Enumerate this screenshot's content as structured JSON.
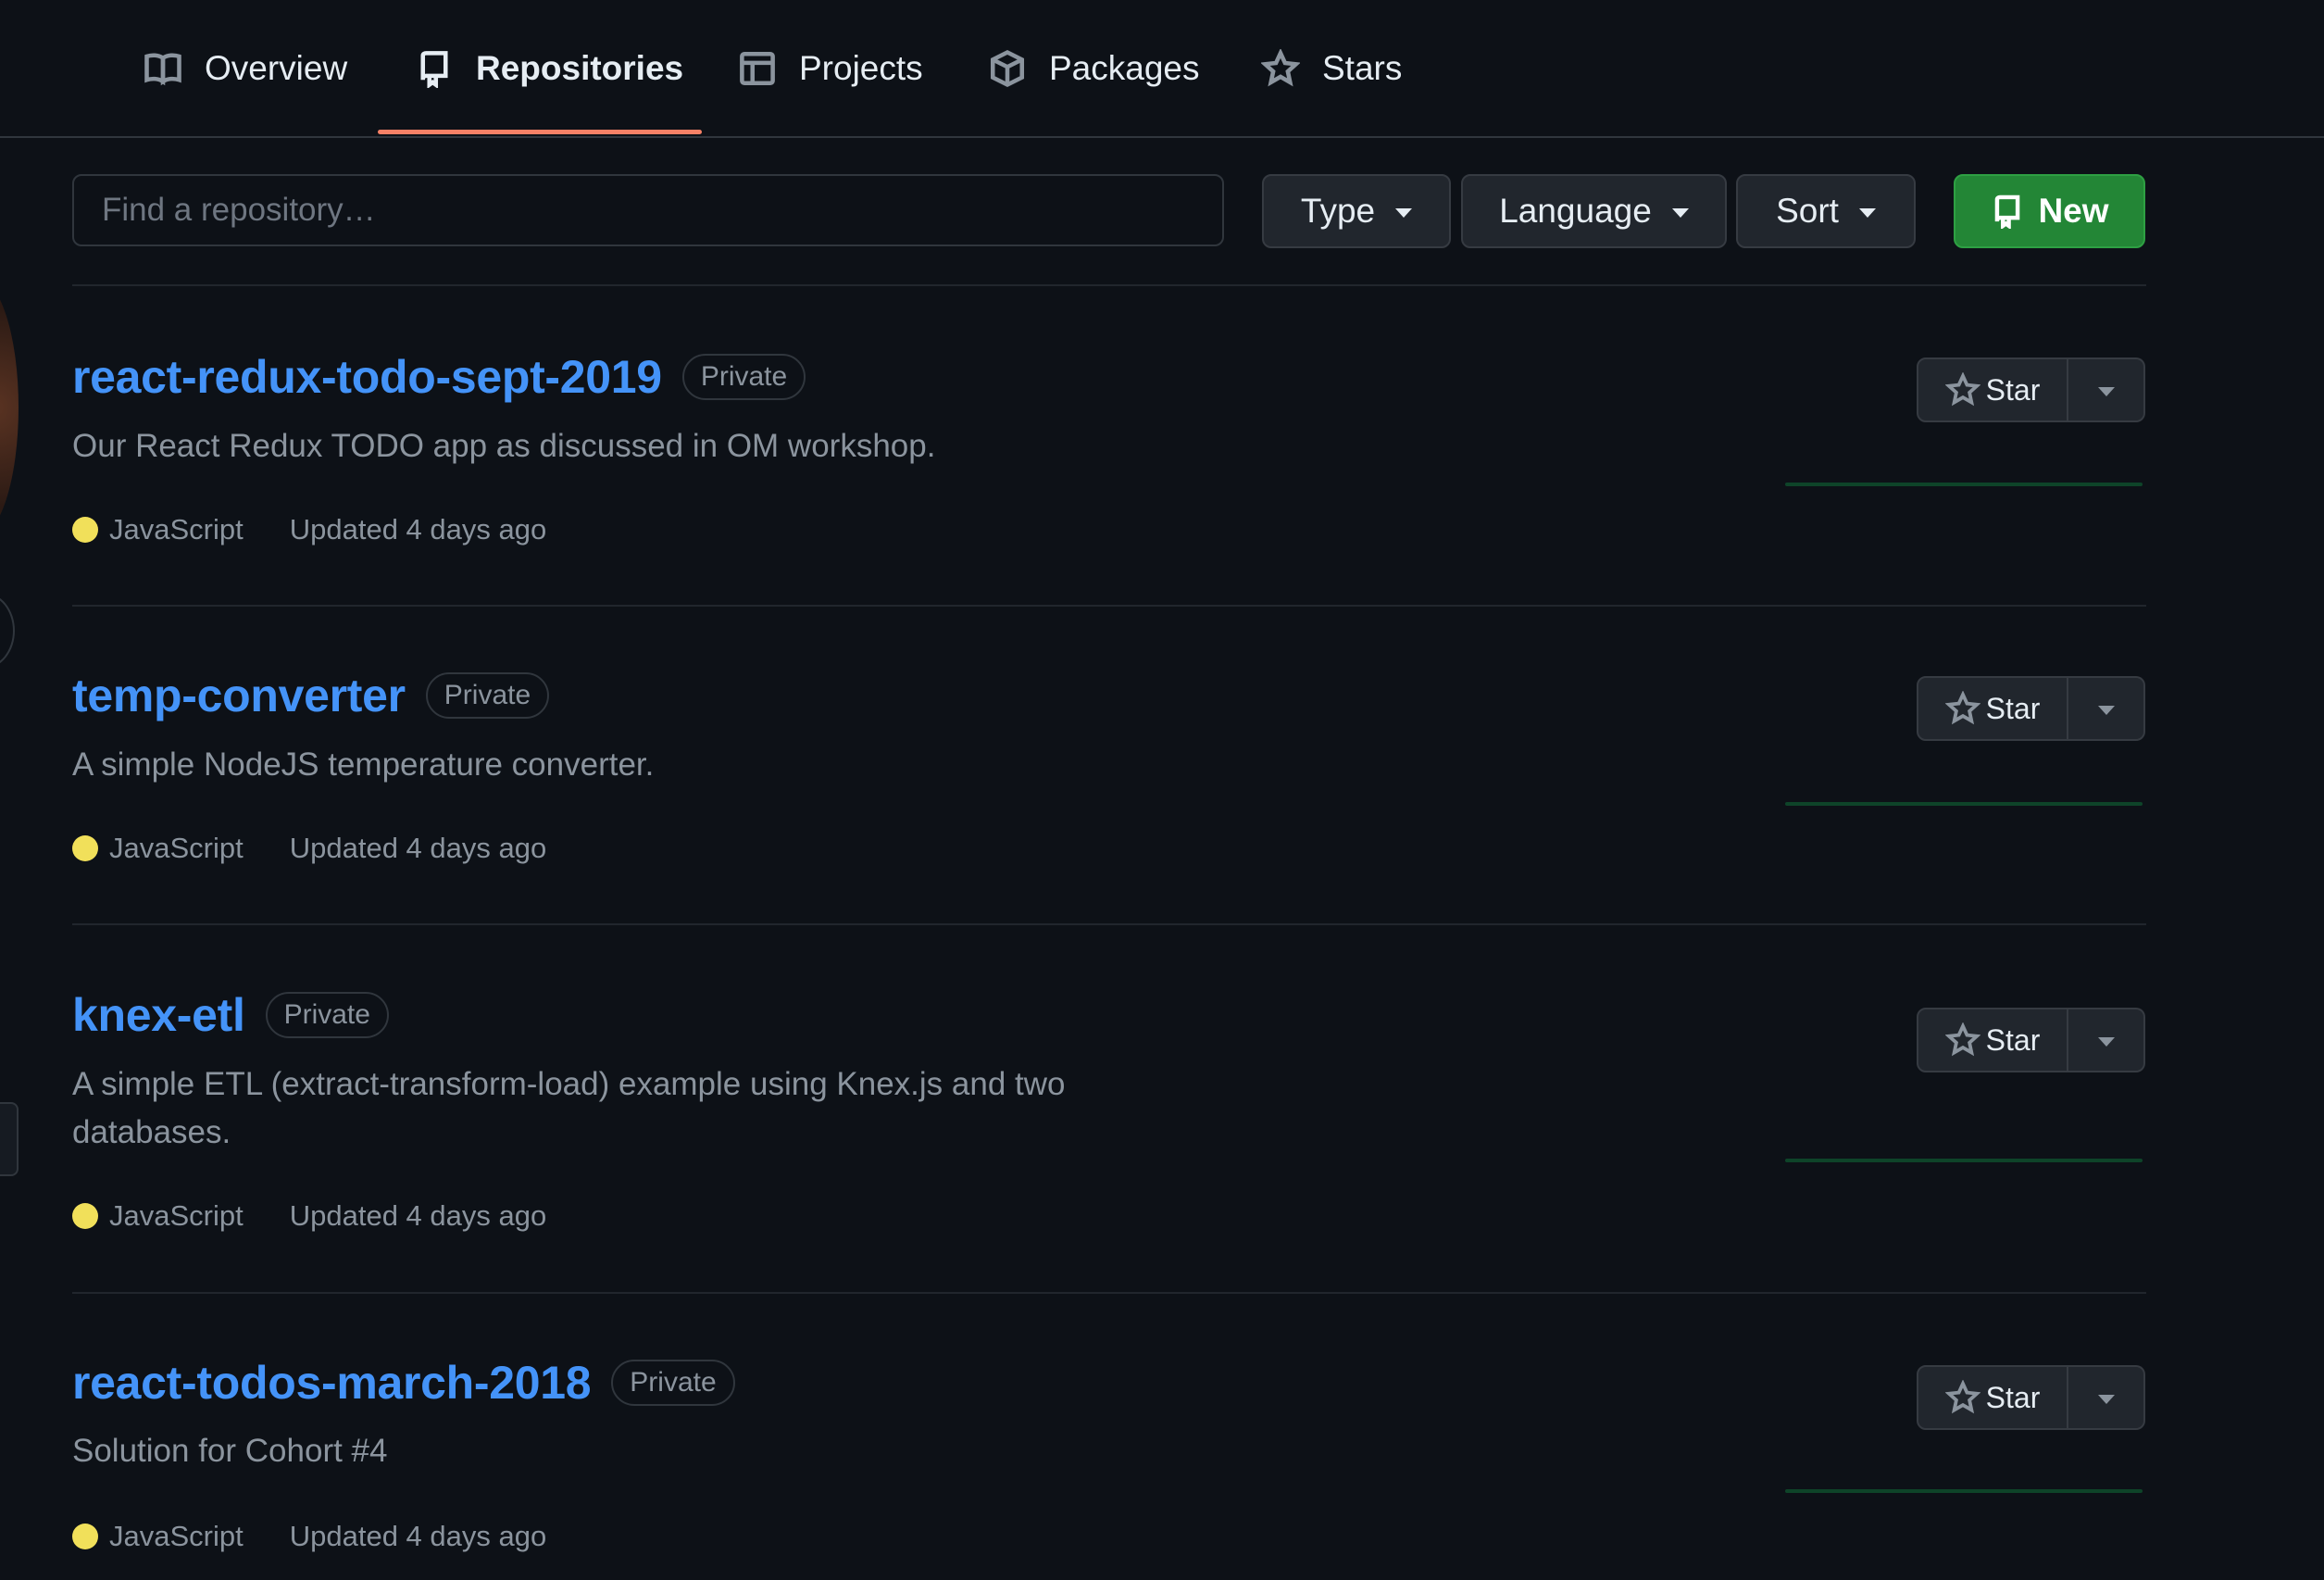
{
  "nav": {
    "tabs": [
      {
        "label": "Overview",
        "icon": "book-icon",
        "active": false
      },
      {
        "label": "Repositories",
        "icon": "repo-icon",
        "active": true
      },
      {
        "label": "Projects",
        "icon": "table-icon",
        "active": false
      },
      {
        "label": "Packages",
        "icon": "package-icon",
        "active": false
      },
      {
        "label": "Stars",
        "icon": "star-icon",
        "active": false
      }
    ]
  },
  "filters": {
    "search_placeholder": "Find a repository…",
    "type_label": "Type",
    "language_label": "Language",
    "sort_label": "Sort",
    "new_label": "New"
  },
  "colors": {
    "link": "#4493f8",
    "accent_underline": "#f78166",
    "new_button": "#238636",
    "javascript": "#f1e05a",
    "sparkline": "#0e4429"
  },
  "repos": [
    {
      "name": "react-redux-todo-sept-2019",
      "visibility": "Private",
      "description": "Our React Redux TODO app as discussed in OM workshop.",
      "language": "JavaScript",
      "updated": "Updated 4 days ago",
      "star_label": "Star"
    },
    {
      "name": "temp-converter",
      "visibility": "Private",
      "description": "A simple NodeJS temperature converter.",
      "language": "JavaScript",
      "updated": "Updated 4 days ago",
      "star_label": "Star"
    },
    {
      "name": "knex-etl",
      "visibility": "Private",
      "description": "A simple ETL (extract-transform-load) example using Knex.js and two databases.",
      "language": "JavaScript",
      "updated": "Updated 4 days ago",
      "star_label": "Star"
    },
    {
      "name": "react-todos-march-2018",
      "visibility": "Private",
      "description": "Solution for Cohort #4",
      "language": "JavaScript",
      "updated": "Updated 4 days ago",
      "star_label": "Star"
    }
  ]
}
